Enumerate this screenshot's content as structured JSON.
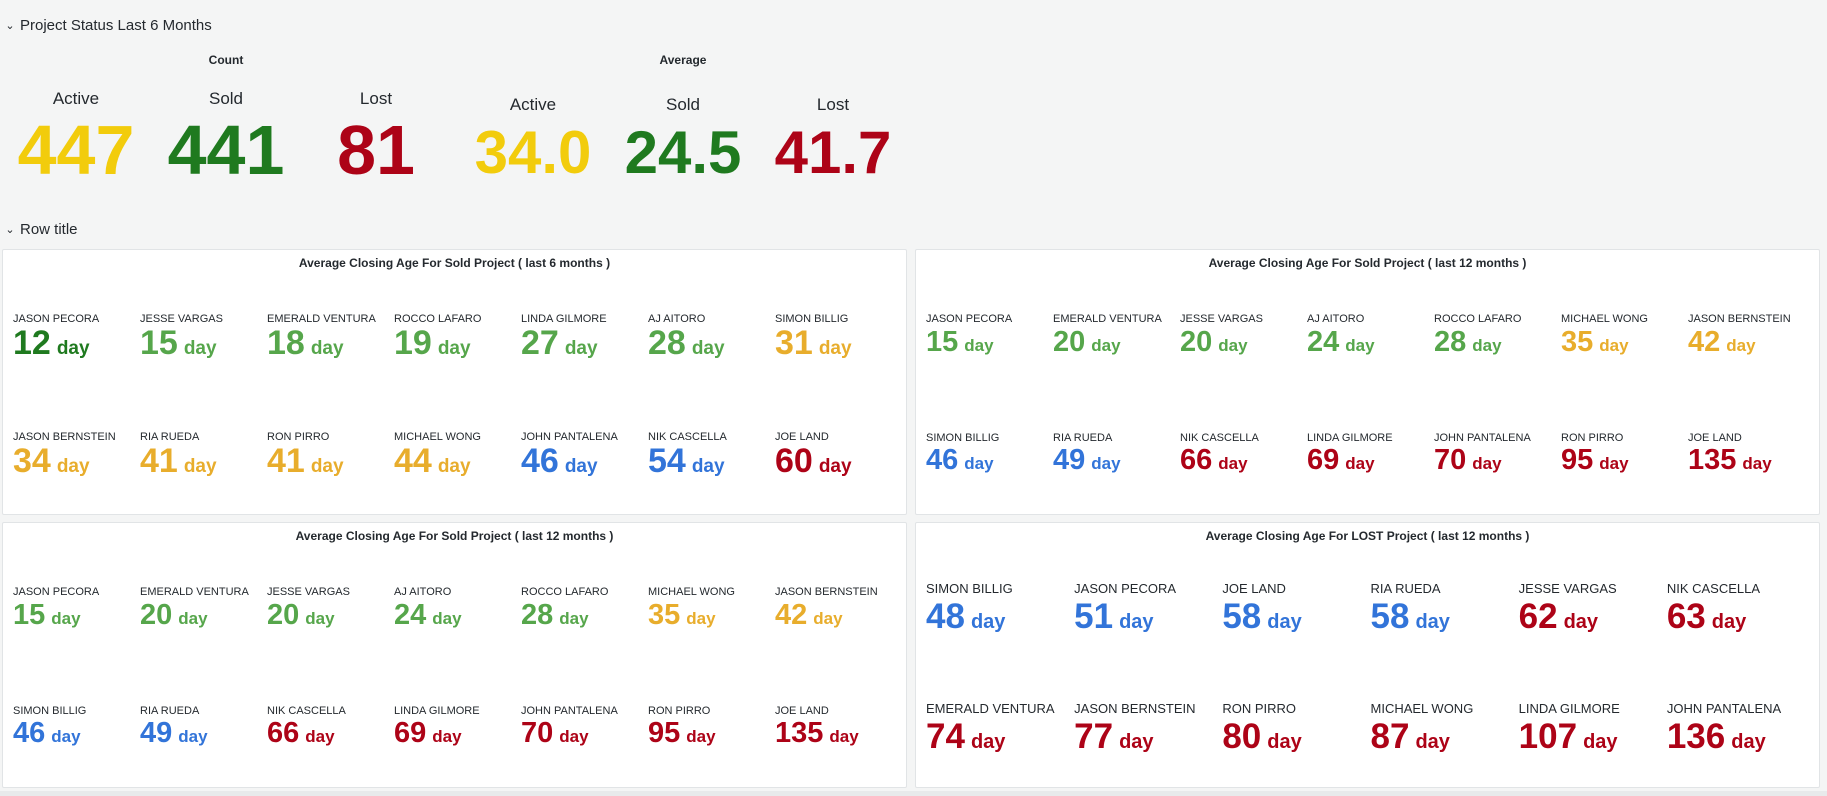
{
  "colors": {
    "yellow": "#f2cc0c",
    "dark_green": "#1f7a1f",
    "red": "#ad0317",
    "green": "#56a64b",
    "orange": "#e8ad2c",
    "blue": "#3274d9"
  },
  "status_row": {
    "title": "Project Status Last 6 Months",
    "count_title": "Count",
    "average_title": "Average",
    "count": [
      {
        "label": "Active",
        "value": "447",
        "color": "#f2cc0c"
      },
      {
        "label": "Sold",
        "value": "441",
        "color": "#1f7a1f"
      },
      {
        "label": "Lost",
        "value": "81",
        "color": "#ad0317"
      }
    ],
    "average": [
      {
        "label": "Active",
        "value": "34.0",
        "color": "#f2cc0c"
      },
      {
        "label": "Sold",
        "value": "24.5",
        "color": "#1f7a1f"
      },
      {
        "label": "Lost",
        "value": "41.7",
        "color": "#ad0317"
      }
    ]
  },
  "row2_title": "Row title",
  "unit": "day",
  "panels": [
    {
      "title": "Average Closing Age For Sold Project ( last 6 months )",
      "items": [
        {
          "name": "JASON PECORA",
          "value": "12",
          "color": "#1f7a1f"
        },
        {
          "name": "JESSE VARGAS",
          "value": "15",
          "color": "#56a64b"
        },
        {
          "name": "EMERALD VENTURA",
          "value": "18",
          "color": "#56a64b"
        },
        {
          "name": "ROCCO LAFARO",
          "value": "19",
          "color": "#56a64b"
        },
        {
          "name": "LINDA GILMORE",
          "value": "27",
          "color": "#56a64b"
        },
        {
          "name": "AJ AITORO",
          "value": "28",
          "color": "#56a64b"
        },
        {
          "name": "SIMON BILLIG",
          "value": "31",
          "color": "#e8ad2c"
        },
        {
          "name": "JASON BERNSTEIN",
          "value": "34",
          "color": "#e8ad2c"
        },
        {
          "name": "RIA RUEDA",
          "value": "41",
          "color": "#e8ad2c"
        },
        {
          "name": "RON PIRRO",
          "value": "41",
          "color": "#e8ad2c"
        },
        {
          "name": "MICHAEL WONG",
          "value": "44",
          "color": "#e8ad2c"
        },
        {
          "name": "JOHN PANTALENA",
          "value": "46",
          "color": "#3274d9"
        },
        {
          "name": "NIK CASCELLA",
          "value": "54",
          "color": "#3274d9"
        },
        {
          "name": "JOE LAND",
          "value": "60",
          "color": "#ad0317"
        }
      ]
    },
    {
      "title": "Average Closing Age For Sold Project ( last 12 months )",
      "items": [
        {
          "name": "JASON PECORA",
          "value": "15",
          "color": "#56a64b"
        },
        {
          "name": "EMERALD VENTURA",
          "value": "20",
          "color": "#56a64b"
        },
        {
          "name": "JESSE VARGAS",
          "value": "20",
          "color": "#56a64b"
        },
        {
          "name": "AJ AITORO",
          "value": "24",
          "color": "#56a64b"
        },
        {
          "name": "ROCCO LAFARO",
          "value": "28",
          "color": "#56a64b"
        },
        {
          "name": "MICHAEL WONG",
          "value": "35",
          "color": "#e8ad2c"
        },
        {
          "name": "JASON BERNSTEIN",
          "value": "42",
          "color": "#e8ad2c"
        },
        {
          "name": "SIMON BILLIG",
          "value": "46",
          "color": "#3274d9"
        },
        {
          "name": "RIA RUEDA",
          "value": "49",
          "color": "#3274d9"
        },
        {
          "name": "NIK CASCELLA",
          "value": "66",
          "color": "#ad0317"
        },
        {
          "name": "LINDA GILMORE",
          "value": "69",
          "color": "#ad0317"
        },
        {
          "name": "JOHN PANTALENA",
          "value": "70",
          "color": "#ad0317"
        },
        {
          "name": "RON PIRRO",
          "value": "95",
          "color": "#ad0317"
        },
        {
          "name": "JOE LAND",
          "value": "135",
          "color": "#ad0317"
        }
      ]
    },
    {
      "title": "Average Closing Age For Sold Project ( last 12 months )",
      "items": [
        {
          "name": "JASON PECORA",
          "value": "15",
          "color": "#56a64b"
        },
        {
          "name": "EMERALD VENTURA",
          "value": "20",
          "color": "#56a64b"
        },
        {
          "name": "JESSE VARGAS",
          "value": "20",
          "color": "#56a64b"
        },
        {
          "name": "AJ AITORO",
          "value": "24",
          "color": "#56a64b"
        },
        {
          "name": "ROCCO LAFARO",
          "value": "28",
          "color": "#56a64b"
        },
        {
          "name": "MICHAEL WONG",
          "value": "35",
          "color": "#e8ad2c"
        },
        {
          "name": "JASON BERNSTEIN",
          "value": "42",
          "color": "#e8ad2c"
        },
        {
          "name": "SIMON BILLIG",
          "value": "46",
          "color": "#3274d9"
        },
        {
          "name": "RIA RUEDA",
          "value": "49",
          "color": "#3274d9"
        },
        {
          "name": "NIK CASCELLA",
          "value": "66",
          "color": "#ad0317"
        },
        {
          "name": "LINDA GILMORE",
          "value": "69",
          "color": "#ad0317"
        },
        {
          "name": "JOHN PANTALENA",
          "value": "70",
          "color": "#ad0317"
        },
        {
          "name": "RON PIRRO",
          "value": "95",
          "color": "#ad0317"
        },
        {
          "name": "JOE LAND",
          "value": "135",
          "color": "#ad0317"
        }
      ]
    },
    {
      "title": "Average Closing Age For LOST Project ( last 12 months )",
      "items": [
        {
          "name": "SIMON BILLIG",
          "value": "48",
          "color": "#3274d9"
        },
        {
          "name": "JASON PECORA",
          "value": "51",
          "color": "#3274d9"
        },
        {
          "name": "JOE LAND",
          "value": "58",
          "color": "#3274d9"
        },
        {
          "name": "RIA RUEDA",
          "value": "58",
          "color": "#3274d9"
        },
        {
          "name": "JESSE VARGAS",
          "value": "62",
          "color": "#ad0317"
        },
        {
          "name": "NIK CASCELLA",
          "value": "63",
          "color": "#ad0317"
        },
        {
          "name": "EMERALD VENTURA",
          "value": "74",
          "color": "#ad0317"
        },
        {
          "name": "JASON BERNSTEIN",
          "value": "77",
          "color": "#ad0317"
        },
        {
          "name": "RON PIRRO",
          "value": "80",
          "color": "#ad0317"
        },
        {
          "name": "MICHAEL WONG",
          "value": "87",
          "color": "#ad0317"
        },
        {
          "name": "LINDA GILMORE",
          "value": "107",
          "color": "#ad0317"
        },
        {
          "name": "JOHN PANTALENA",
          "value": "136",
          "color": "#ad0317"
        }
      ]
    }
  ]
}
